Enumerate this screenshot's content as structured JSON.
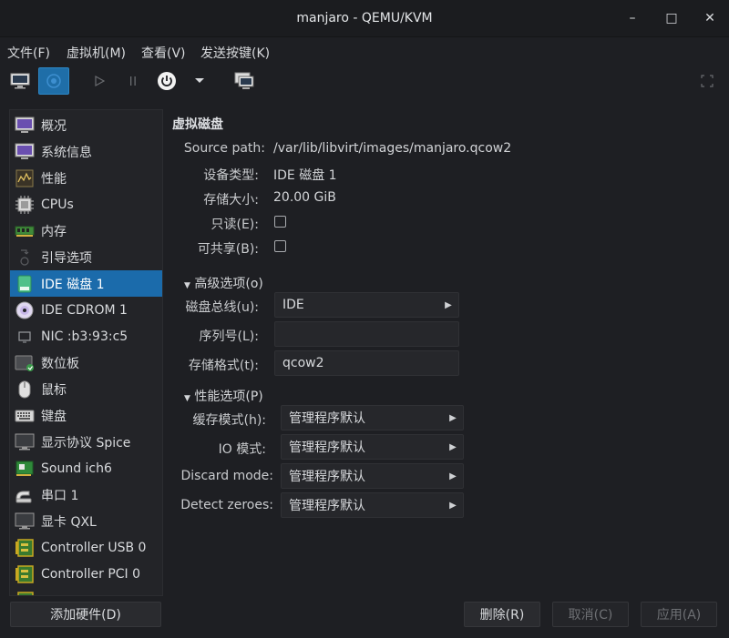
{
  "window": {
    "title": "manjaro - QEMU/KVM",
    "minimize": "–",
    "maximize": "□",
    "close": "✕"
  },
  "menubar": [
    {
      "label": "文件(F)"
    },
    {
      "label": "虚拟机(M)"
    },
    {
      "label": "查看(V)"
    },
    {
      "label": "发送按键(K)"
    }
  ],
  "sidebar": {
    "items": [
      {
        "label": "概况",
        "icon": "overview-icon"
      },
      {
        "label": "系统信息",
        "icon": "system-info-icon"
      },
      {
        "label": "性能",
        "icon": "performance-icon"
      },
      {
        "label": "CPUs",
        "icon": "cpu-icon"
      },
      {
        "label": "内存",
        "icon": "memory-icon"
      },
      {
        "label": "引导选项",
        "icon": "boot-icon"
      },
      {
        "label": "IDE 磁盘 1",
        "icon": "disk-icon",
        "selected": true
      },
      {
        "label": "IDE CDROM 1",
        "icon": "cdrom-icon"
      },
      {
        "label": "NIC :b3:93:c5",
        "icon": "nic-icon"
      },
      {
        "label": "数位板",
        "icon": "tablet-icon"
      },
      {
        "label": "鼠标",
        "icon": "mouse-icon"
      },
      {
        "label": "键盘",
        "icon": "keyboard-icon"
      },
      {
        "label": "显示协议 Spice",
        "icon": "display-icon"
      },
      {
        "label": "Sound ich6",
        "icon": "sound-icon"
      },
      {
        "label": "串口 1",
        "icon": "serial-icon"
      },
      {
        "label": "显卡 QXL",
        "icon": "video-icon"
      },
      {
        "label": "Controller USB 0",
        "icon": "controller-icon"
      },
      {
        "label": "Controller PCI 0",
        "icon": "controller-icon"
      }
    ]
  },
  "main": {
    "section_title": "虚拟磁盘",
    "source_path_label": "Source path:",
    "source_path_value": "/var/lib/libvirt/images/manjaro.qcow2",
    "device_type_label": "设备类型:",
    "device_type_value": "IDE 磁盘 1",
    "storage_size_label": "存储大小:",
    "storage_size_value": "20.00 GiB",
    "readonly_label": "只读(E):",
    "shareable_label": "可共享(B):",
    "advanced": {
      "label": "高级选项(o)",
      "disk_bus_label": "磁盘总线(u):",
      "disk_bus_value": "IDE",
      "serial_label": "序列号(L):",
      "serial_value": "",
      "format_label": "存储格式(t):",
      "format_value": "qcow2"
    },
    "performance": {
      "label": "性能选项(P)",
      "cache_label": "缓存模式(h):",
      "cache_value": "管理程序默认",
      "io_label": "IO 模式:",
      "io_value": "管理程序默认",
      "discard_label": "Discard mode:",
      "discard_value": "管理程序默认",
      "detect_label": "Detect zeroes:",
      "detect_value": "管理程序默认"
    }
  },
  "footer": {
    "add_hardware": "添加硬件(D)",
    "remove": "删除(R)",
    "cancel": "取消(C)",
    "apply": "应用(A)"
  },
  "colors": {
    "accent": "#1b6bab",
    "background": "#1e1f23"
  }
}
